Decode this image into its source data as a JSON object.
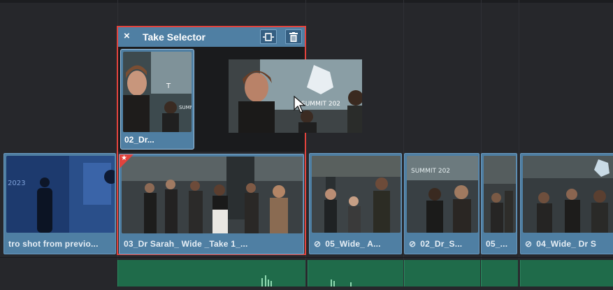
{
  "take_selector": {
    "title": "Take Selector",
    "close_icon": "×",
    "alt_take_label": "02_Dr...",
    "selected_take_label": "03_Dr Sarah_ Wide _Take 1_...",
    "accent_color": "#e2433d"
  },
  "clips": {
    "intro_label": "tro shot from previo...",
    "clip2_label": "05_Wide_ A...",
    "clip3_label": "02_Dr_S...",
    "clip4_label": "05_...",
    "clip5_label": "04_Wide_ Dr S"
  },
  "thumbnail_text": {
    "summit_partial": "SUMMIT 202",
    "summit_t": "T",
    "summit_abbr": "SUMM"
  },
  "icons": {
    "close": "close-icon",
    "trim": "trim-icon",
    "delete": "trash-icon",
    "link": "link-icon",
    "cursor": "mouse-cursor-icon",
    "flag": "star-flag-icon"
  },
  "colors": {
    "clip_blue": "#4f7fa3",
    "audio_green": "#1f6b4a",
    "selection_red": "#e2433d",
    "timeline_bg": "#26272b"
  }
}
